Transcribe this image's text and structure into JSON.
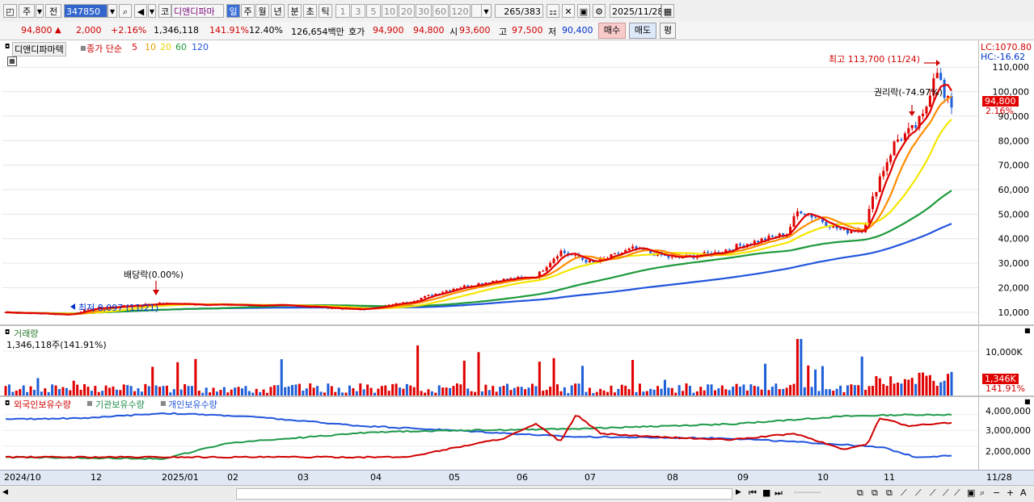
{
  "toolbar": {
    "market": "주",
    "prev_btn": "전",
    "code": "347850",
    "name_prefix": "코",
    "stock_name": "디앤디파마",
    "periods": [
      "일",
      "주",
      "월",
      "년",
      "분",
      "초",
      "틱"
    ],
    "numbers": [
      "1",
      "3",
      "5",
      "10",
      "20",
      "30",
      "60",
      "120"
    ],
    "count": "265",
    "total": "/383",
    "date": "2025/11/28"
  },
  "quote": {
    "price": "94,800",
    "arrow": "▲",
    "change": "2,000",
    "pct": "+2.16%",
    "volume": "1,346,118",
    "vol_ratio": "141.91%",
    "turnover": "12.40%",
    "amount": "126,654백만",
    "hoga_label": "호가",
    "ask": "94,900",
    "bid": "94,800",
    "open_label": "시",
    "open": "93,600",
    "high_label": "고",
    "high": "97,500",
    "low_label": "저",
    "low": "90,400",
    "buy_btn": "매수",
    "sell_btn": "매도",
    "eval_btn": "평"
  },
  "price_pane": {
    "stock_label": "디앤디파마텍",
    "ma_title": "종가 단순",
    "ma_periods": [
      "5",
      "10",
      "20",
      "60",
      "120"
    ],
    "high_note": "최고 113,700 (11/24)",
    "low_note": "최저 8,097 (11/21)",
    "dividend_note": "배당락(0.00%)",
    "rights_note": "권리락(-74.97%)",
    "lc": "LC:1070.80",
    "hc": "HC:-16.62",
    "last_price": "94,800",
    "last_pct": "2.16%"
  },
  "volume_pane": {
    "title": "거래량",
    "value": "1,346,118주(141.91%)",
    "axis_label": "10,000K",
    "last_tag": "1,346K",
    "last_pct": "141.91%"
  },
  "holding_pane": {
    "series": [
      "외국인보유수량",
      "기관보유수량",
      "개인보유수량"
    ],
    "axis": [
      "4,000,000",
      "3,000,000",
      "2,000,000"
    ]
  },
  "x_labels": [
    "2024/10",
    "12",
    "2025/01",
    "02",
    "03",
    "04",
    "05",
    "06",
    "07",
    "08",
    "09",
    "10",
    "11"
  ],
  "x_last": "11/28",
  "chart_data": {
    "type": "line",
    "series_name": "디앤디파마텍",
    "ylim": [
      5000,
      116000
    ],
    "y_ticks": [
      10000,
      20000,
      30000,
      40000,
      50000,
      60000,
      70000,
      80000,
      90000,
      100000,
      110000
    ],
    "months": [
      "2024/10",
      "12",
      "2025/01",
      "02",
      "03",
      "04",
      "05",
      "06",
      "07",
      "08",
      "09",
      "10",
      "11"
    ],
    "close_approx": [
      [
        "2024/10",
        10000
      ],
      [
        "2024/11",
        9000
      ],
      [
        "2024/12",
        12000
      ],
      [
        "2025/01",
        13500
      ],
      [
        "2025/02",
        12500
      ],
      [
        "2025/03",
        12500
      ],
      [
        "2025/04",
        11000
      ],
      [
        "2025/05",
        20000
      ],
      [
        "2025/06",
        24000
      ],
      [
        "2025/07",
        32000
      ],
      [
        "2025/08",
        34000
      ],
      [
        "2025/09",
        40000
      ],
      [
        "2025/10",
        44000
      ],
      [
        "2025/11",
        94800
      ]
    ],
    "price_high": 113700,
    "price_low": 8097,
    "last_close": 94800,
    "colors": {
      "ma5": "#e00000",
      "ma10": "#ff8c00",
      "ma20": "#f5e600",
      "ma60": "#1e9a3c",
      "ma120": "#2255dd",
      "up": "#e00000",
      "down": "#1f5fd8"
    }
  }
}
